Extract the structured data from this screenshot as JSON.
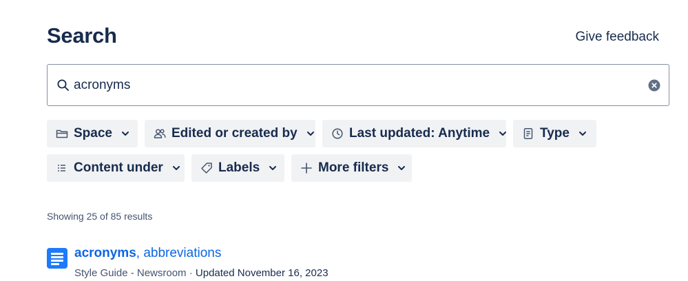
{
  "header": {
    "title": "Search",
    "feedback_label": "Give feedback"
  },
  "search": {
    "value": "acronyms",
    "search_icon": "search-icon",
    "clear_icon": "clear-icon"
  },
  "filters": [
    {
      "label": "Space",
      "icon": "folder-icon"
    },
    {
      "label": "Edited or created by",
      "icon": "people-icon"
    },
    {
      "label": "Last updated: Anytime",
      "icon": "clock-icon"
    },
    {
      "label": "Type",
      "icon": "page-icon"
    },
    {
      "label": "Content under",
      "icon": "list-icon"
    },
    {
      "label": "Labels",
      "icon": "tag-icon"
    },
    {
      "label": "More filters",
      "icon": "plus-icon"
    }
  ],
  "results": {
    "count_text": "Showing 25 of 85 results",
    "items": [
      {
        "title_match": "acronyms",
        "title_rest": ", abbreviations",
        "space": "Style Guide - Newsroom",
        "separator": " · ",
        "updated": "Updated November 16, 2023",
        "icon": "document-icon"
      }
    ]
  },
  "colors": {
    "accent": "#0c66e4",
    "text": "#172b4d",
    "chip_bg": "#f1f2f4",
    "doc_icon": "#1d7afc"
  }
}
